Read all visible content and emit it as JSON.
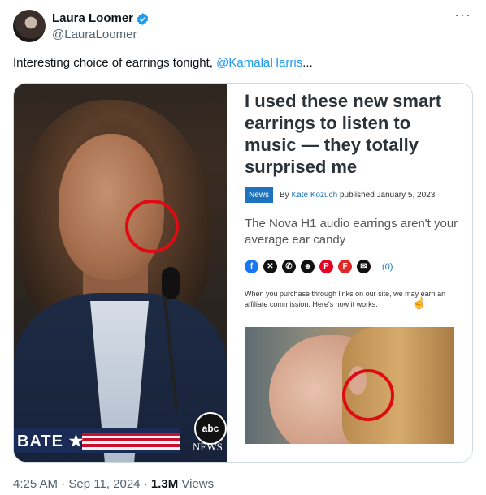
{
  "author": {
    "display_name": "Laura Loomer",
    "handle": "@LauraLoomer",
    "verified_icon": "verified-badge-icon"
  },
  "tweet": {
    "text_prefix": "Interesting choice of earrings tonight, ",
    "mention": "@KamalaHarris",
    "text_suffix": "..."
  },
  "media": {
    "left_photo": {
      "banner_text": "BATE",
      "banner_star": "★",
      "channel_logo": "abc",
      "channel_sub": "NEWS",
      "highlight_color": "#e00b12"
    },
    "article": {
      "headline": "I used these new smart earrings to listen to music — they totally surprised me",
      "category_badge": "News",
      "byline_prefix": "By",
      "author": "Kate Kozuch",
      "published": "published January 5, 2023",
      "subhead": "The Nova H1 audio earrings aren't your average ear candy",
      "share_icons": [
        {
          "name": "facebook-icon",
          "glyph": "f",
          "color": "#1877f2"
        },
        {
          "name": "x-icon",
          "glyph": "✕",
          "color": "#111111"
        },
        {
          "name": "whatsapp-icon",
          "glyph": "✆",
          "color": "#111111"
        },
        {
          "name": "reddit-icon",
          "glyph": "☻",
          "color": "#111111"
        },
        {
          "name": "pinterest-icon",
          "glyph": "P",
          "color": "#e60023"
        },
        {
          "name": "flipboard-icon",
          "glyph": "F",
          "color": "#e12828"
        },
        {
          "name": "email-icon",
          "glyph": "✉",
          "color": "#111111"
        }
      ],
      "comments": "(0)",
      "disclaimer": "When you purchase through links on our site, we may earn an affiliate commission.",
      "disclaimer_link": "Here's how it works."
    }
  },
  "footer": {
    "time": "4:25 AM",
    "separator": " · ",
    "date": "Sep 11, 2024",
    "separator2": " · ",
    "views_count": "1.3M",
    "views_label": " Views"
  },
  "more_menu": "···"
}
